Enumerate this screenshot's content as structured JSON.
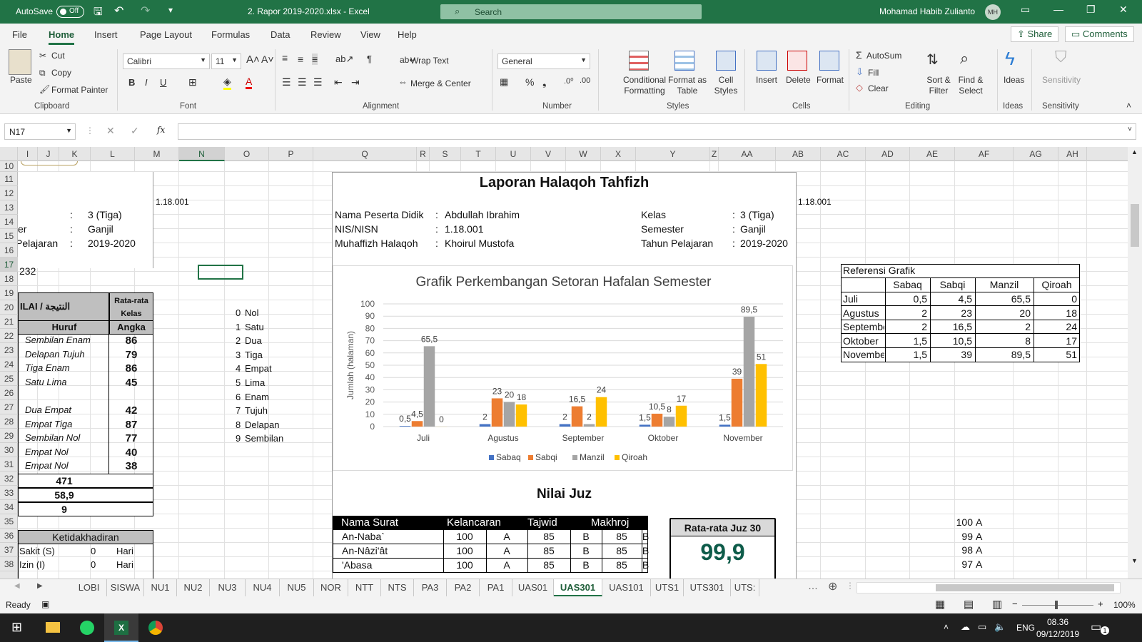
{
  "window": {
    "autosave_label": "AutoSave",
    "autosave_state": "Off",
    "title": "2. Rapor 2019-2020.xlsx  -  Excel",
    "search_placeholder": "Search",
    "user_name": "Mohamad Habib Zulianto",
    "user_initials": "MH"
  },
  "menu": {
    "tabs": [
      "File",
      "Home",
      "Insert",
      "Page Layout",
      "Formulas",
      "Data",
      "Review",
      "View",
      "Help"
    ],
    "active": "Home",
    "share": "Share",
    "comments": "Comments"
  },
  "ribbon": {
    "clipboard": {
      "paste": "Paste",
      "cut": "Cut",
      "copy": "Copy",
      "format_painter": "Format Painter",
      "group": "Clipboard"
    },
    "font": {
      "name": "Calibri",
      "size": "11",
      "bold": "B",
      "italic": "I",
      "underline": "U",
      "group": "Font"
    },
    "alignment": {
      "wrap": "Wrap Text",
      "merge": "Merge & Center",
      "group": "Alignment"
    },
    "number": {
      "format": "General",
      "group": "Number"
    },
    "styles": {
      "conditional": "Conditional Formatting",
      "format_table": "Format as Table",
      "cell_styles": "Cell Styles",
      "group": "Styles"
    },
    "cells": {
      "insert": "Insert",
      "delete": "Delete",
      "format": "Format",
      "group": "Cells"
    },
    "editing": {
      "autosum": "AutoSum",
      "fill": "Fill",
      "clear": "Clear",
      "sort": "Sort & Filter",
      "find": "Find & Select",
      "group": "Editing"
    },
    "ideas": {
      "label": "Ideas",
      "group": "Ideas"
    },
    "sensitivity": {
      "label": "Sensitivity",
      "group": "Sensitivity"
    }
  },
  "formula_bar": {
    "name_box": "N17",
    "fx": "fx",
    "value": ""
  },
  "columns": [
    "I",
    "J",
    "K",
    "L",
    "M",
    "N",
    "O",
    "P",
    "Q",
    "R",
    "S",
    "T",
    "U",
    "V",
    "W",
    "X",
    "Y",
    "Z",
    "AA",
    "AB",
    "AC",
    "AD",
    "AE",
    "AF",
    "AG",
    "AH"
  ],
  "rows": [
    "10",
    "11",
    "12",
    "13",
    "14",
    "15",
    "16",
    "17",
    "18",
    "19",
    "20",
    "21",
    "22",
    "23",
    "24",
    "25",
    "26",
    "27",
    "28",
    "29",
    "30",
    "31",
    "32",
    "33",
    "34",
    "35",
    "36",
    "37",
    "38"
  ],
  "left": {
    "id_code": "1.18.001",
    "kelas_label": "er",
    "info_rows": [
      {
        "label": "",
        "colon": ":",
        "value": "3 (Tiga)"
      },
      {
        "label": "er",
        "colon": ":",
        "value": "Ganjil"
      },
      {
        "label": "Pelajaran",
        "colon": ":",
        "value": "2019-2020"
      }
    ],
    "r17": "232",
    "nilai_header": "ILAI / النتيجة",
    "rata_header": "Rata-rata Kelas",
    "huruf_header": "Huruf",
    "angka_header": "Angka",
    "grades": [
      {
        "huruf": "Sembilan Enam",
        "angka": "86"
      },
      {
        "huruf": "Delapan Tujuh",
        "angka": "79"
      },
      {
        "huruf": "Tiga Enam",
        "angka": "86"
      },
      {
        "huruf": "Satu Lima",
        "angka": "45"
      },
      {
        "huruf": "",
        "angka": ""
      },
      {
        "huruf": "Dua Empat",
        "angka": "42"
      },
      {
        "huruf": "Empat Tiga",
        "angka": "87"
      },
      {
        "huruf": "Sembilan Nol",
        "angka": "77"
      },
      {
        "huruf": "Empat Nol",
        "angka": "40"
      },
      {
        "huruf": "Empat Nol",
        "angka": "38"
      }
    ],
    "total": "471",
    "average": "58,9",
    "rank": "9",
    "absence_header": "Ketidakhadiran",
    "absence_rows": [
      {
        "label": "Sakit (S)",
        "count": "0",
        "unit": "Hari"
      },
      {
        "label": "Izin (I)",
        "count": "0",
        "unit": "Hari"
      }
    ],
    "number_words": [
      {
        "n": "0",
        "w": "Nol"
      },
      {
        "n": "1",
        "w": "Satu"
      },
      {
        "n": "2",
        "w": "Dua"
      },
      {
        "n": "3",
        "w": "Tiga"
      },
      {
        "n": "4",
        "w": "Empat"
      },
      {
        "n": "5",
        "w": "Lima"
      },
      {
        "n": "6",
        "w": "Enam"
      },
      {
        "n": "7",
        "w": "Tujuh"
      },
      {
        "n": "8",
        "w": "Delapan"
      },
      {
        "n": "9",
        "w": "Sembilan"
      }
    ]
  },
  "report": {
    "title": "Laporan Halaqoh Tahfizh",
    "id_code": "1.18.001",
    "fields": [
      {
        "label": "Nama Peserta Didik",
        "value": "Abdullah Ibrahim"
      },
      {
        "label": "NIS/NISN",
        "value": "1.18.001"
      },
      {
        "label": "Muhaffizh Halaqoh",
        "value": "Khoirul Mustofa"
      }
    ],
    "fields_right": [
      {
        "label": "Kelas",
        "value": "3 (Tiga)"
      },
      {
        "label": "Semester",
        "value": "Ganjil"
      },
      {
        "label": "Tahun Pelajaran",
        "value": "2019-2020"
      }
    ],
    "colon": ":",
    "nilai_juz_title": "Nilai Juz",
    "juz_headers": [
      "Nama Surat",
      "Kelancaran",
      "Tajwid",
      "Makhroj"
    ],
    "juz_rows": [
      {
        "surat": "An-Naba`",
        "kel": "100",
        "kel_g": "A",
        "taj": "85",
        "taj_g": "B",
        "mak": "85",
        "mak_g": "B"
      },
      {
        "surat": "An-Nâzi'ât",
        "kel": "100",
        "kel_g": "A",
        "taj": "85",
        "taj_g": "B",
        "mak": "85",
        "mak_g": "B"
      },
      {
        "surat": "'Abasa",
        "kel": "100",
        "kel_g": "A",
        "taj": "85",
        "taj_g": "B",
        "mak": "85",
        "mak_g": "B"
      }
    ],
    "rata_juz_label": "Rata-rata Juz 30",
    "rata_juz_value": "99,9"
  },
  "reference": {
    "title": "Referensi Grafik",
    "headers": [
      "Sabaq",
      "Sabqi",
      "Manzil",
      "Qiroah"
    ],
    "rows": [
      {
        "m": "Juli",
        "v": [
          "0,5",
          "4,5",
          "65,5",
          "0"
        ]
      },
      {
        "m": "Agustus",
        "v": [
          "2",
          "23",
          "20",
          "18"
        ]
      },
      {
        "m": "September",
        "v": [
          "2",
          "16,5",
          "2",
          "24"
        ]
      },
      {
        "m": "Oktober",
        "v": [
          "1,5",
          "10,5",
          "8",
          "17"
        ]
      },
      {
        "m": "November",
        "v": [
          "1,5",
          "39",
          "89,5",
          "51"
        ]
      }
    ],
    "grade_scale": [
      {
        "score": "100",
        "grade": "A"
      },
      {
        "score": "99",
        "grade": "A"
      },
      {
        "score": "98",
        "grade": "A"
      },
      {
        "score": "97",
        "grade": "A"
      }
    ]
  },
  "chart_data": {
    "type": "bar",
    "title": "Grafik Perkembangan Setoran Hafalan Semester",
    "ylabel": "Jumlah (halaman)",
    "xlabel": "",
    "ylim": [
      0,
      100
    ],
    "yticks": [
      "0",
      "10",
      "20",
      "30",
      "40",
      "50",
      "60",
      "70",
      "80",
      "90",
      "100"
    ],
    "categories": [
      "Juli",
      "Agustus",
      "September",
      "Oktober",
      "November"
    ],
    "series": [
      {
        "name": "Sabaq",
        "color": "#4472c4",
        "values": [
          0.5,
          2,
          2,
          1.5,
          1.5
        ],
        "labels": [
          "0,5",
          "2",
          "2",
          "1,5",
          "1,5"
        ]
      },
      {
        "name": "Sabqi",
        "color": "#ed7d31",
        "values": [
          4.5,
          23,
          16.5,
          10.5,
          39
        ],
        "labels": [
          "4,5",
          "23",
          "16,5",
          "10,5",
          "39"
        ]
      },
      {
        "name": "Manzil",
        "color": "#a5a5a5",
        "values": [
          65.5,
          20,
          2,
          8,
          89.5
        ],
        "labels": [
          "65,5",
          "20",
          "2",
          "8",
          "89,5"
        ]
      },
      {
        "name": "Qiroah",
        "color": "#ffc000",
        "values": [
          0,
          18,
          24,
          17,
          51
        ],
        "labels": [
          "0",
          "18",
          "24",
          "17",
          "51"
        ]
      }
    ],
    "legend": "bottom",
    "grid": true
  },
  "sheet_tabs": [
    "LOBI",
    "SISWA",
    "NU1",
    "NU2",
    "NU3",
    "NU4",
    "NU5",
    "NOR",
    "NTT",
    "NTS",
    "PA3",
    "PA2",
    "PA1",
    "UAS01",
    "UAS301",
    "UAS101",
    "UTS1",
    "UTS301",
    "UTS:"
  ],
  "active_sheet": "UAS301",
  "status": {
    "ready": "Ready",
    "zoom": "100%"
  },
  "taskbar": {
    "lang": "ENG",
    "time": "08.36",
    "date": "09/12/2019",
    "notif": "1"
  }
}
